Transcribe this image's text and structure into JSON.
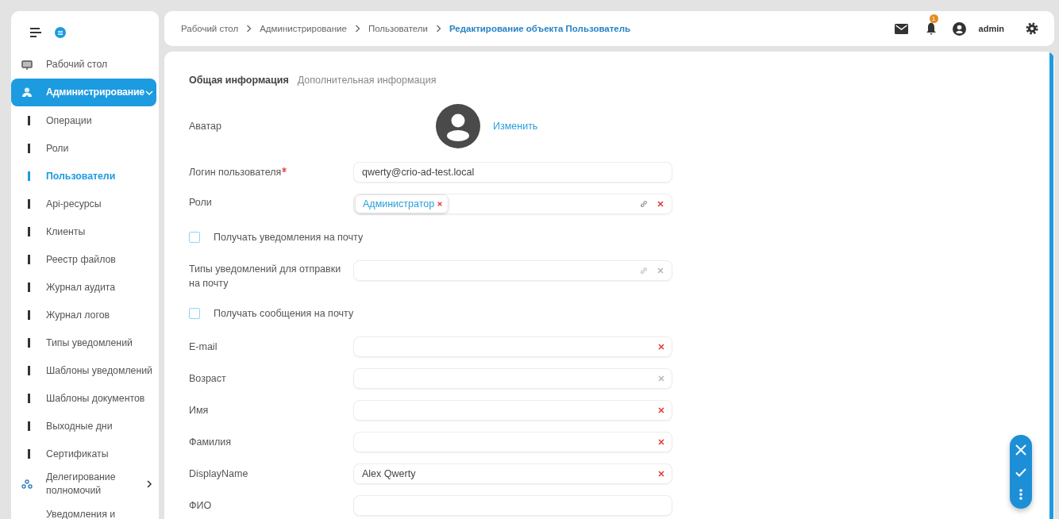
{
  "sidebar": {
    "items": [
      {
        "kind": "top",
        "label": "Рабочий стол",
        "selected": false
      },
      {
        "kind": "group",
        "label": "Администрирование",
        "selected": true,
        "expanded": true,
        "children": [
          {
            "label": "Операции",
            "selected": false
          },
          {
            "label": "Роли",
            "selected": false
          },
          {
            "label": "Пользователи",
            "selected": true
          },
          {
            "label": "Api-ресурсы",
            "selected": false
          },
          {
            "label": "Клиенты",
            "selected": false
          },
          {
            "label": "Реестр файлов",
            "selected": false
          },
          {
            "label": "Журнал аудита",
            "selected": false
          },
          {
            "label": "Журнал логов",
            "selected": false
          },
          {
            "label": "Типы уведомлений",
            "selected": false
          },
          {
            "label": "Шаблоны уведомлений",
            "selected": false
          },
          {
            "label": "Шаблоны документов",
            "selected": false
          },
          {
            "label": "Выходные дни",
            "selected": false
          },
          {
            "label": "Сертификаты",
            "selected": false
          }
        ]
      },
      {
        "kind": "group",
        "label": "Делегирование полномочий",
        "selected": false,
        "expanded": false
      },
      {
        "kind": "top",
        "label": "Уведомления и",
        "selected": false
      }
    ]
  },
  "topbar": {
    "breadcrumbs": [
      {
        "label": "Рабочий стол",
        "current": false
      },
      {
        "label": "Администрирование",
        "current": false
      },
      {
        "label": "Пользователи",
        "current": false
      },
      {
        "label": "Редактирование объекта Пользователь",
        "current": true
      }
    ],
    "notification_count": "1",
    "user": "admin"
  },
  "form": {
    "tabs": [
      {
        "label": "Общая информация",
        "selected": true
      },
      {
        "label": "Дополнительная информация",
        "selected": false
      }
    ],
    "rows": [
      {
        "kind": "avatar",
        "label": "Аватар",
        "action": "Изменить"
      },
      {
        "kind": "field",
        "label": "Логин пользователя",
        "required": true,
        "value": "qwerty@crio-ad-test.local"
      },
      {
        "kind": "tags",
        "label": "Роли",
        "tags": [
          "Администратор"
        ],
        "clear_active": true
      },
      {
        "kind": "checkbox",
        "label": "Получать уведомления на почту",
        "checked": false
      },
      {
        "kind": "tags",
        "label": "Типы уведомлений для отправки на почту",
        "clear_active": false
      },
      {
        "kind": "checkbox",
        "label": "Получать сообщения на почту",
        "checked": false
      },
      {
        "kind": "field",
        "label": "E-mail",
        "required": false,
        "clear_active": true
      },
      {
        "kind": "field",
        "label": "Возраст",
        "required": false,
        "clear_active": false
      },
      {
        "kind": "field",
        "label": "Имя",
        "required": false,
        "clear_active": true
      },
      {
        "kind": "field",
        "label": "Фамилия",
        "required": false,
        "clear_active": true
      },
      {
        "kind": "field",
        "label": "DisplayName",
        "required": false,
        "value": "Alex Qwerty",
        "clear_active": true
      },
      {
        "kind": "field",
        "label": "ФИО",
        "required": false
      }
    ]
  }
}
